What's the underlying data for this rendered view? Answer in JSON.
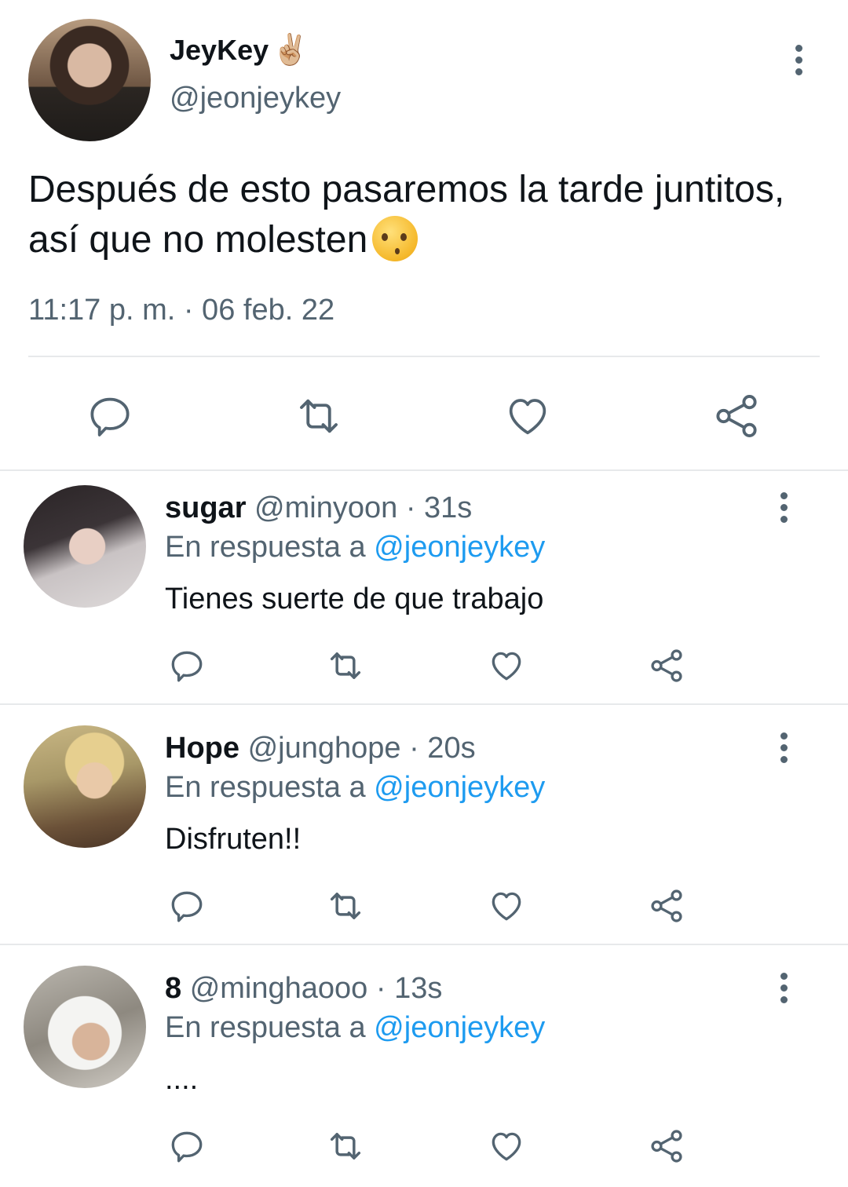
{
  "main_tweet": {
    "display_name": "JeyKey",
    "name_emoji": "✌🏼",
    "handle": "@jeonjeykey",
    "text": "Después de esto pasaremos la tarde juntitos, así que no molesten",
    "timestamp": "11:17 p. m. · 06 feb. 22"
  },
  "replies": [
    {
      "name": "sugar",
      "handle": "@minyoon",
      "time": "· 31s",
      "reply_prefix": "En respuesta a",
      "reply_to": "@jeonjeykey",
      "text": "Tienes suerte de que trabajo"
    },
    {
      "name": "Hope",
      "handle": "@junghope",
      "time": "· 20s",
      "reply_prefix": "En respuesta a",
      "reply_to": "@jeonjeykey",
      "text": "Disfruten!!"
    },
    {
      "name": "8",
      "handle": "@minghaooo",
      "time": "· 13s",
      "reply_prefix": "En respuesta a",
      "reply_to": "@jeonjeykey",
      "text": "...."
    }
  ],
  "icons": [
    "reply-icon",
    "retweet-icon",
    "like-icon",
    "share-icon",
    "more-options-icon"
  ],
  "colors": {
    "text": "#0f1419",
    "secondary": "#536471",
    "link": "#1d9bf0",
    "divider": "#e7e9eb"
  }
}
